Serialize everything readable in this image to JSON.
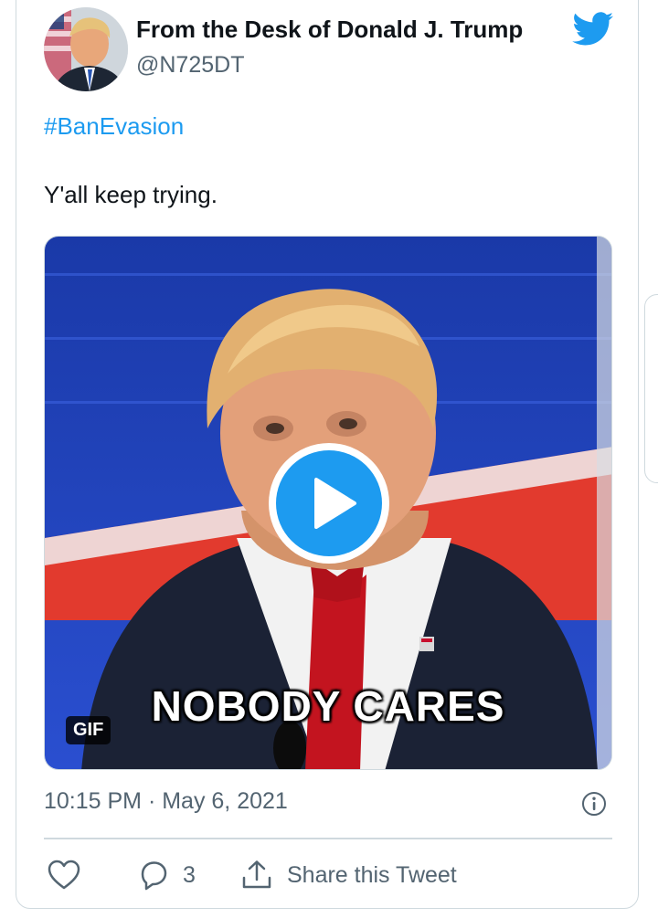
{
  "tweet": {
    "author_name": "From the Desk of Donald J. Trump",
    "author_handle": "@N725DT",
    "hashtag": "#BanEvasion",
    "text": "Y'all keep trying.",
    "timestamp": "10:15 PM · May 6, 2021"
  },
  "media": {
    "caption": "NOBODY CARES",
    "badge": "GIF",
    "type": "gif"
  },
  "actions": {
    "reply_count": "3",
    "share_label": "Share this Tweet"
  },
  "icons": [
    "twitter-logo-icon",
    "play-icon",
    "info-icon",
    "heart-icon",
    "reply-icon",
    "share-icon"
  ],
  "colors": {
    "accent": "#1d9bf0",
    "text": "#0f1419",
    "secondary": "#536471",
    "border": "#cfd9de"
  }
}
